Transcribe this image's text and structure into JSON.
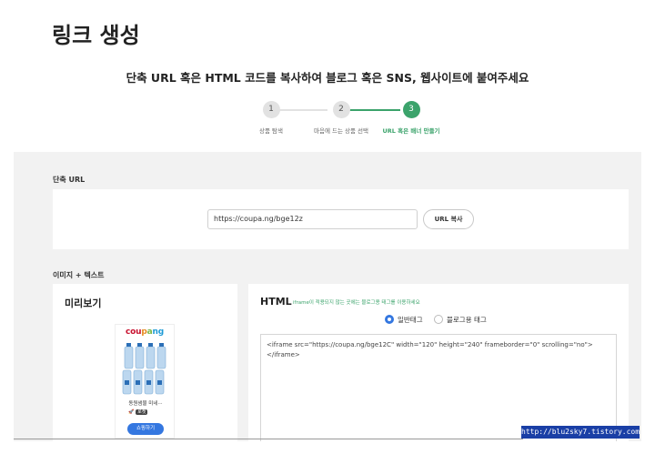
{
  "header": {
    "title": "링크 생성",
    "subtitle": "단축 URL 혹은 HTML 코드를 복사하여 블로그 혹은 SNS, 웹사이트에 붙여주세요"
  },
  "steps": [
    {
      "number": "1",
      "label": "상품 탐색",
      "active": false
    },
    {
      "number": "2",
      "label": "마음에 드는 상품 선택",
      "active": false
    },
    {
      "number": "3",
      "label": "URL 혹은 배너 만들기",
      "active": true
    }
  ],
  "short_url": {
    "section_label": "단축 URL",
    "value": "https://coupa.ng/bge12z",
    "copy_button": "URL 복사"
  },
  "image_text": {
    "section_label": "이미지 + 텍스트",
    "preview": {
      "title": "미리보기",
      "ad": {
        "logo": [
          "cou",
          "p",
          "a",
          "ng"
        ],
        "product_name": "동원샘물 미네···",
        "rocket_badge": "로켓",
        "shop_button": "쇼핑하기"
      }
    },
    "html": {
      "title": "HTML",
      "note": "iframe이 적용되지 않는 곳에는 블로그용 태그를 이용하세요",
      "radio_general": "일반태그",
      "radio_blog": "블로그용 태그",
      "code": "<iframe src=\"https://coupa.ng/bge12C\" width=\"120\" height=\"240\" frameborder=\"0\" scrolling=\"no\"></iframe>"
    }
  },
  "watermark": "http://blu2sky7.tistory.com",
  "colors": {
    "accent_green": "#3ba36b",
    "primary_blue": "#3477e0",
    "background": "#f2f2f2"
  }
}
